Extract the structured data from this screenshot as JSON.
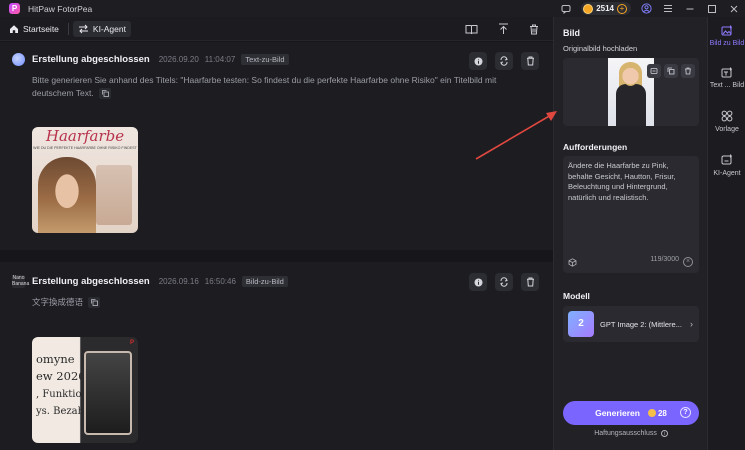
{
  "titlebar": {
    "app_title": "HitPaw FotorPea",
    "credits": "2514"
  },
  "toolbar": {
    "home_label": "Startseite",
    "agent_label": "KI-Agent"
  },
  "chat": {
    "cards": [
      {
        "title": "Erstellung abgeschlossen",
        "date": "2026.09.20",
        "time": "11:04:07",
        "tag": "Text-zu-Bild",
        "prompt": "Bitte generieren Sie anhand des Titels: \"Haarfarbe testen: So findest du die perfekte Haarfarbe ohne Risiko\" ein Titelbild mit deutschem Text.",
        "thumb_title": "Haarfarbe",
        "thumb_sub": "WIE DU DIE PERFEKTE HAARFARBE OHNE RISIKO FINDEST"
      },
      {
        "title": "Erstellung abgeschlossen",
        "date": "2026.09.16",
        "time": "16:50:46",
        "tag": "Bild-zu-Bild",
        "prompt": "文字換成德语",
        "avatar_text": "Nano Banana",
        "thumb_lines": [
          "omyne",
          "ew 2026:",
          ", Funktionen",
          "ys. Bezahlt"
        ],
        "thumb_badge": "P"
      }
    ]
  },
  "panel": {
    "title": "Bild",
    "upload_label": "Originalbild hochladen",
    "prompt_section": "Aufforderungen",
    "prompt_text": "Ändere die Haarfarbe zu Pink, behalte Gesicht, Hautton, Frisur, Beleuchtung und Hintergrund, natürlich und realistisch.",
    "char_count": "119/3000",
    "model_section": "Modell",
    "model_name": "GPT Image 2: (Mittlere...",
    "model_thumb_text": "2",
    "generate_label": "Generieren",
    "generate_cost": "28",
    "disclaimer": "Haftungsausschluss"
  },
  "sidebar": {
    "items": [
      {
        "label": "Bild zu Bild",
        "icon": "image-to-image-icon"
      },
      {
        "label": "Text ... Bild",
        "icon": "text-to-image-icon"
      },
      {
        "label": "Vorlage",
        "icon": "template-icon"
      },
      {
        "label": "KI-Agent",
        "icon": "ai-agent-icon"
      }
    ]
  },
  "colors": {
    "accent": "#7a66ff",
    "sidebar_active": "#8f7bff",
    "arrow": "#e0483f",
    "coin": "#f5a623"
  }
}
